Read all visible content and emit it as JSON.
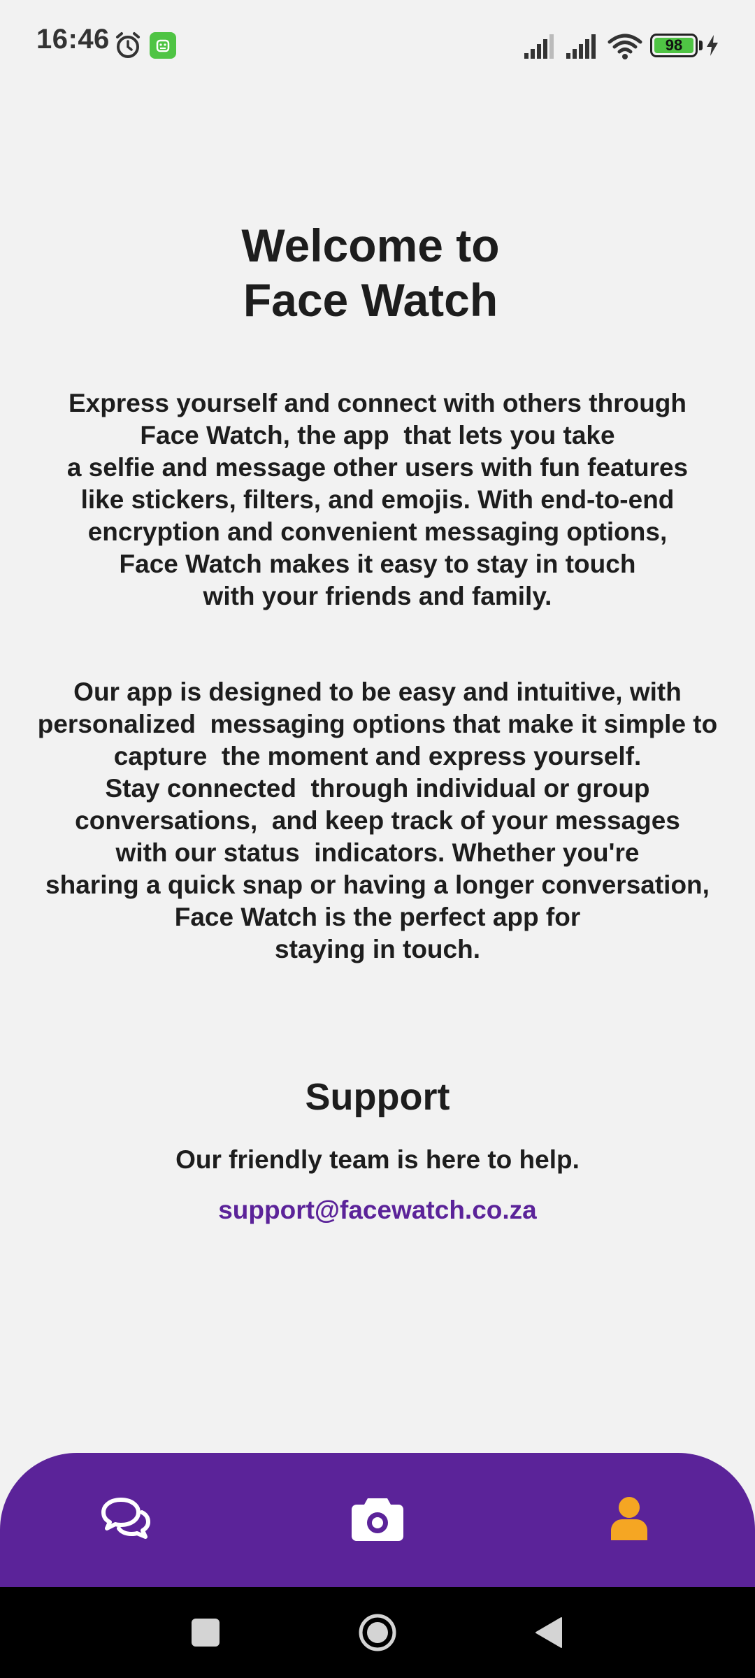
{
  "status_bar": {
    "time": "16:46",
    "battery_level": "98",
    "icons": [
      "alarm-icon",
      "app-notification-icon",
      "cellular-signal-icon",
      "cellular-signal-icon",
      "wifi-icon",
      "battery-icon",
      "charging-icon"
    ]
  },
  "welcome": {
    "title_line1": "Welcome to",
    "title_line2": "Face Watch"
  },
  "intro": {
    "lines": [
      "Express yourself and connect with others through",
      "Face Watch, the app  that lets you take",
      "a selfie and message other users with fun features",
      "like stickers, filters, and emojis. With end-to-end",
      "encryption and convenient messaging options,",
      "Face Watch makes it easy to stay in touch",
      "with your friends and family."
    ]
  },
  "about": {
    "lines": [
      "Our app is designed to be easy and intuitive, with",
      "personalized  messaging options that make it simple to",
      "capture  the moment and express yourself.",
      "Stay connected  through individual or group",
      "conversations,  and keep track of your messages",
      "with our status  indicators. Whether you're",
      "sharing a quick snap or having a longer conversation,",
      "Face Watch is the perfect app for",
      "staying in touch."
    ]
  },
  "support": {
    "title": "Support",
    "text": "Our friendly team is here to help.",
    "email": "support@facewatch.co.za"
  },
  "bottom_nav": {
    "items": [
      {
        "name": "chats",
        "icon": "chat-bubbles-icon"
      },
      {
        "name": "camera",
        "icon": "camera-icon"
      },
      {
        "name": "profile",
        "icon": "person-icon",
        "active": true
      }
    ]
  },
  "colors": {
    "background": "#f2f2f2",
    "primary": "#5b2399",
    "active_icon": "#f5a623",
    "text": "#1d1d1d"
  }
}
